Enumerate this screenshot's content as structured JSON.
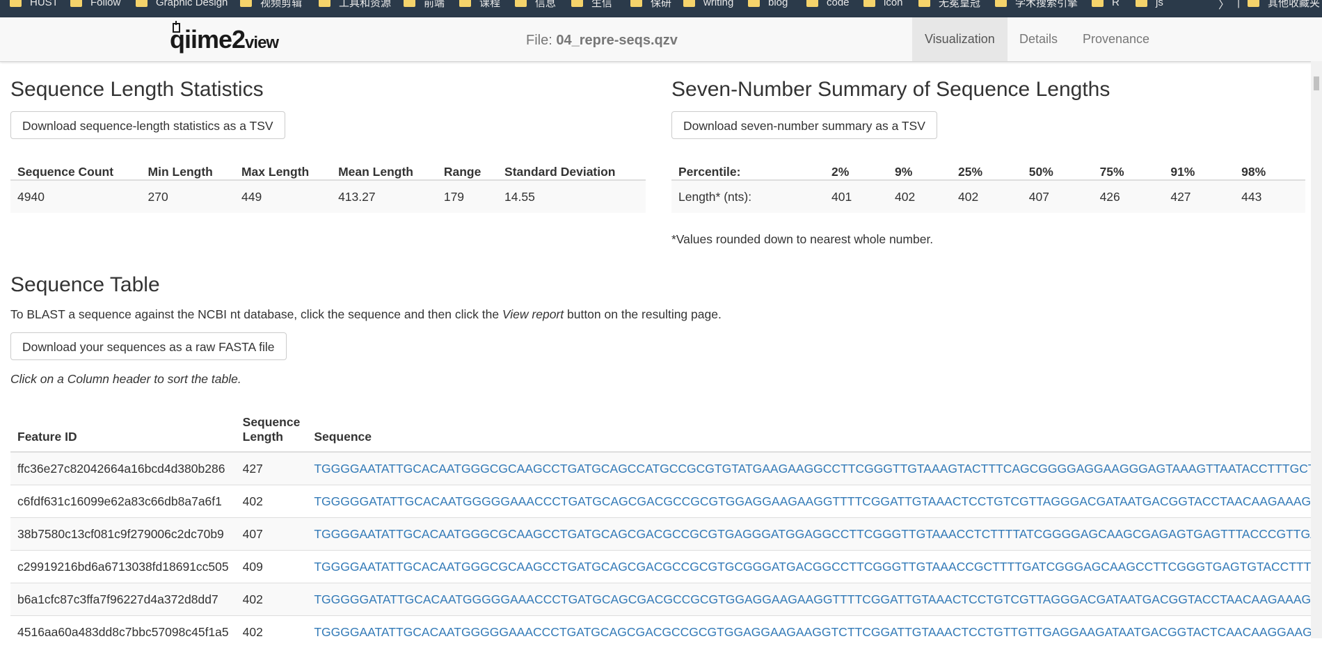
{
  "bookmarks": [
    {
      "label": "HUST"
    },
    {
      "label": "Follow"
    },
    {
      "label": "Graphic Design"
    },
    {
      "label": "视频剪辑"
    },
    {
      "label": "工具和资源"
    },
    {
      "label": "前端"
    },
    {
      "label": "课程"
    },
    {
      "label": "信息"
    },
    {
      "label": "生信"
    },
    {
      "label": "保研"
    },
    {
      "label": "writing"
    },
    {
      "label": "blog"
    },
    {
      "label": "code"
    },
    {
      "label": "icon"
    },
    {
      "label": "无冕皇冠"
    },
    {
      "label": "学术搜索引擎"
    },
    {
      "label": "R"
    },
    {
      "label": "js"
    },
    {
      "label": "其他收藏夹"
    }
  ],
  "bookmarks_more": "〉",
  "bookmarks_sep": "|",
  "navbar": {
    "logo_main": "qiime2",
    "logo_sub": "view",
    "file_prefix": "File:",
    "file_name": "04_repre-seqs.qzv",
    "tabs": [
      {
        "label": "Visualization",
        "active": true
      },
      {
        "label": "Details",
        "active": false
      },
      {
        "label": "Provenance",
        "active": false
      }
    ]
  },
  "length_stats": {
    "title": "Sequence Length Statistics",
    "download_label": "Download sequence-length statistics as a TSV",
    "headers": [
      "Sequence Count",
      "Min Length",
      "Max Length",
      "Mean Length",
      "Range",
      "Standard Deviation"
    ],
    "values": [
      "4940",
      "270",
      "449",
      "413.27",
      "179",
      "14.55"
    ]
  },
  "seven_number": {
    "title": "Seven-Number Summary of Sequence Lengths",
    "download_label": "Download seven-number summary as a TSV",
    "headers": [
      "Percentile:",
      "2%",
      "9%",
      "25%",
      "50%",
      "75%",
      "91%",
      "98%"
    ],
    "values": [
      "Length* (nts):",
      "401",
      "402",
      "402",
      "407",
      "426",
      "427",
      "443"
    ],
    "footnote": "*Values rounded down to nearest whole number."
  },
  "sequence_table": {
    "title": "Sequence Table",
    "blast_prefix": "To BLAST a sequence against the NCBI nt database, click the sequence and then click the ",
    "blast_italic": "View report",
    "blast_suffix": " button on the resulting page.",
    "download_label": "Download your sequences as a raw FASTA file",
    "sort_hint": "Click on a Column header to sort the table.",
    "headers": {
      "feature_id": "Feature ID",
      "length_line1": "Sequence",
      "length_line2": "Length",
      "sequence": "Sequence"
    },
    "rows": [
      {
        "id": "ffc36e27c82042664a16bcd4d380b286",
        "length": "427",
        "seq": "TGGGGAATATTGCACAATGGGCGCAAGCCTGATGCAGCCATGCCGCGTGTATGAAGAAGGCCTTCGGGTTGTAAAGTACTTTCAGCGGGGAGGAAGGGAGTAAAGTTAATACCTTTGCTCATTGA"
      },
      {
        "id": "c6fdf631c16099e62a83c66db8a7a6f1",
        "length": "402",
        "seq": "TGGGGGATATTGCACAATGGGGGAAACCCTGATGCAGCGACGCCGCGTGGAGGAAGAAGGTTTTCGGATTGTAAACTCCTGTCGTTAGGGACGATAATGACGGTACCTAACAAGAAAGCACCG"
      },
      {
        "id": "38b7580c13cf081c9f279006c2dc70b9",
        "length": "407",
        "seq": "TGGGGAATATTGCACAATGGGCGCAAGCCTGATGCAGCGACGCCGCGTGAGGGATGGAGGCCTTCGGGTTGTAAACCTCTTTTATCGGGGAGCAAGCGAGAGTGAGTTTACCCGTTGAATAAG"
      },
      {
        "id": "c29919216bd6a6713038fd18691cc505",
        "length": "409",
        "seq": "TGGGGAATATTGCACAATGGGCGCAAGCCTGATGCAGCGACGCCGCGTGCGGGATGACGGCCTTCGGGTTGTAAACCGCTTTTGATCGGGAGCAAGCCTTCGGGTGAGTGTACCTTTCGAATAA"
      },
      {
        "id": "b6a1cfc87c3ffa7f96227d4a372d8dd7",
        "length": "402",
        "seq": "TGGGGGATATTGCACAATGGGGGAAACCCTGATGCAGCGACGCCGCGTGGAGGAAGAAGGTTTTCGGATTGTAAACTCCTGTCGTTAGGGACGATAATGACGGTACCTAACAAGAAAGCACCG"
      },
      {
        "id": "4516aa60a483dd8c7bbc57098c45f1a5",
        "length": "402",
        "seq": "TGGGGAATATTGCACAATGGGGGAAACCCTGATGCAGCGACGCCGCGTGGAGGAAGAAGGTCTTCGGATTGTAAACTCCTGTTGTTGAGGAAGATAATGACGGTACTCAACAAGGAAGTGACG"
      }
    ]
  },
  "colors": {
    "link": "#337ab7",
    "bookmarks_bg": "#2b3a4a",
    "navbar_bg": "#f8f8f8",
    "folder": "#f5d36b"
  }
}
